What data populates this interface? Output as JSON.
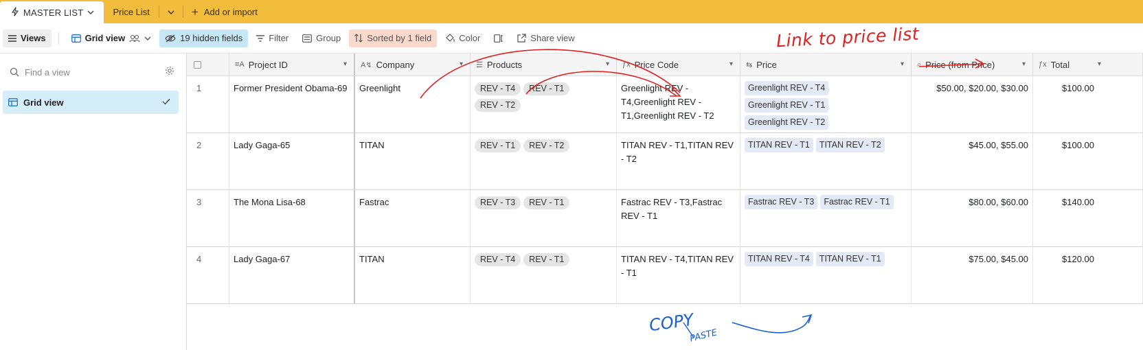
{
  "tabs": {
    "active": "MASTER LIST",
    "second": "Price List",
    "add": "Add or import"
  },
  "toolbar": {
    "views": "Views",
    "grid_view": "Grid view",
    "hidden_fields": "19 hidden fields",
    "filter": "Filter",
    "group": "Group",
    "sorted": "Sorted by 1 field",
    "color": "Color",
    "share": "Share view"
  },
  "sidebar": {
    "find_placeholder": "Find a view",
    "view_item": "Grid view"
  },
  "columns": {
    "project_id": "Project ID",
    "company": "Company",
    "products": "Products",
    "price_code": "Price Code",
    "price": "Price",
    "price_from": "Price (from Price)",
    "total": "Total"
  },
  "rows": [
    {
      "num": "1",
      "project_id": "Former President Obama-69",
      "company": "Greenlight",
      "products": [
        "REV - T4",
        "REV - T1",
        "REV - T2"
      ],
      "price_code": "Greenlight REV - T4,Greenlight REV - T1,Greenlight REV - T2",
      "price": [
        "Greenlight REV - T4",
        "Greenlight REV - T1",
        "Greenlight REV - T2"
      ],
      "price_from": "$50.00, $20.00, $30.00",
      "total": "$100.00"
    },
    {
      "num": "2",
      "project_id": "Lady Gaga-65",
      "company": "TITAN",
      "products": [
        "REV - T1",
        "REV - T2"
      ],
      "price_code": "TITAN REV - T1,TITAN REV - T2",
      "price": [
        "TITAN REV - T1",
        "TITAN REV - T2"
      ],
      "price_from": "$45.00, $55.00",
      "total": "$100.00"
    },
    {
      "num": "3",
      "project_id": "The Mona Lisa-68",
      "company": "Fastrac",
      "products": [
        "REV - T3",
        "REV - T1"
      ],
      "price_code": "Fastrac REV - T3,Fastrac REV - T1",
      "price": [
        "Fastrac REV - T3",
        "Fastrac REV - T1"
      ],
      "price_from": "$80.00, $60.00",
      "total": "$140.00"
    },
    {
      "num": "4",
      "project_id": "Lady Gaga-67",
      "company": "TITAN",
      "products": [
        "REV - T4",
        "REV - T1"
      ],
      "price_code": "TITAN REV - T4,TITAN REV - T1",
      "price": [
        "TITAN REV - T4",
        "TITAN REV - T1"
      ],
      "price_from": "$75.00, $45.00",
      "total": "$120.00"
    }
  ],
  "annotations": {
    "red_note": "Link to price list",
    "blue_note_1": "COPY",
    "blue_note_2": "PASTE",
    "red_color": "#e02020",
    "blue_color": "#1a5fd6"
  },
  "colors": {
    "tabbar": "#f2bd3c",
    "hidden_fields_bg": "#c8e7f5",
    "sorted_bg": "#fbd9cc",
    "selected_view_bg": "#d6eef9"
  }
}
